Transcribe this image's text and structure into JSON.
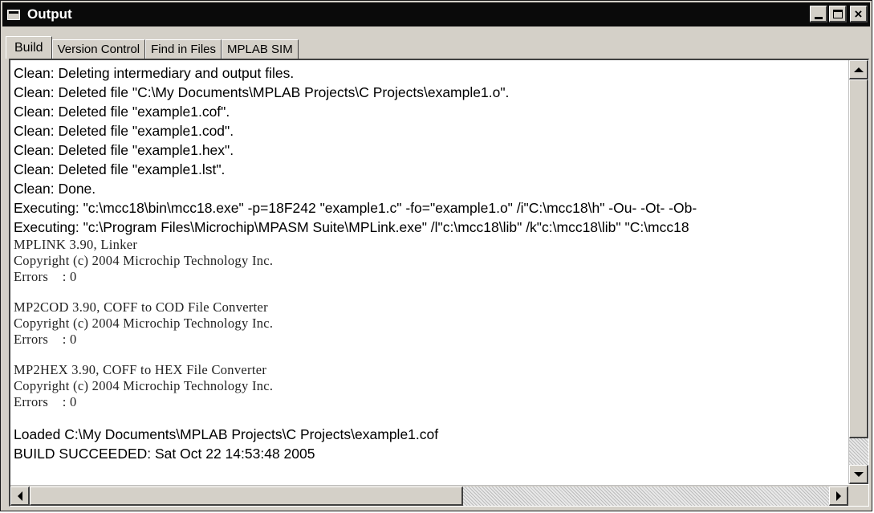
{
  "window": {
    "title": "Output",
    "minimize_icon": "minimize-icon",
    "maximize_icon": "maximize-icon",
    "close_glyph": "×"
  },
  "tabs": [
    {
      "label": "Build",
      "active": true
    },
    {
      "label": "Version Control",
      "active": false
    },
    {
      "label": "Find in Files",
      "active": false
    },
    {
      "label": "MPLAB SIM",
      "active": false
    }
  ],
  "output": {
    "clean_lines": [
      "Clean: Deleting intermediary and output files.",
      "Clean: Deleted file \"C:\\My Documents\\MPLAB Projects\\C Projects\\example1.o\".",
      "Clean: Deleted file \"example1.cof\".",
      "Clean: Deleted file \"example1.cod\".",
      "Clean: Deleted file \"example1.hex\".",
      "Clean: Deleted file \"example1.lst\".",
      "Clean: Done."
    ],
    "exec_lines": [
      "Executing: \"c:\\mcc18\\bin\\mcc18.exe\" -p=18F242 \"example1.c\" -fo=\"example1.o\" /i\"C:\\mcc18\\h\" -Ou- -Ot- -Ob-",
      "Executing: \"c:\\Program Files\\Microchip\\MPASM Suite\\MPLink.exe\" /l\"c:\\mcc18\\lib\" /k\"c:\\mcc18\\lib\" \"C:\\mcc18"
    ],
    "linker_block": [
      "MPLINK 3.90, Linker",
      "Copyright (c) 2004 Microchip Technology Inc.",
      "Errors    : 0"
    ],
    "mp2cod_block": [
      "MP2COD 3.90, COFF to COD File Converter",
      "Copyright (c) 2004 Microchip Technology Inc.",
      "Errors    : 0"
    ],
    "mp2hex_block": [
      "MP2HEX 3.90, COFF to HEX File Converter",
      "Copyright (c) 2004 Microchip Technology Inc.",
      "Errors    : 0"
    ],
    "loaded_line": "Loaded C:\\My Documents\\MPLAB Projects\\C Projects\\example1.cof",
    "result_line": "BUILD SUCCEEDED: Sat Oct 22 14:53:48 2005"
  },
  "colors": {
    "title_bar": "#0a0a0a",
    "window_face": "#d4d0c8",
    "content_bg": "#ffffff"
  }
}
